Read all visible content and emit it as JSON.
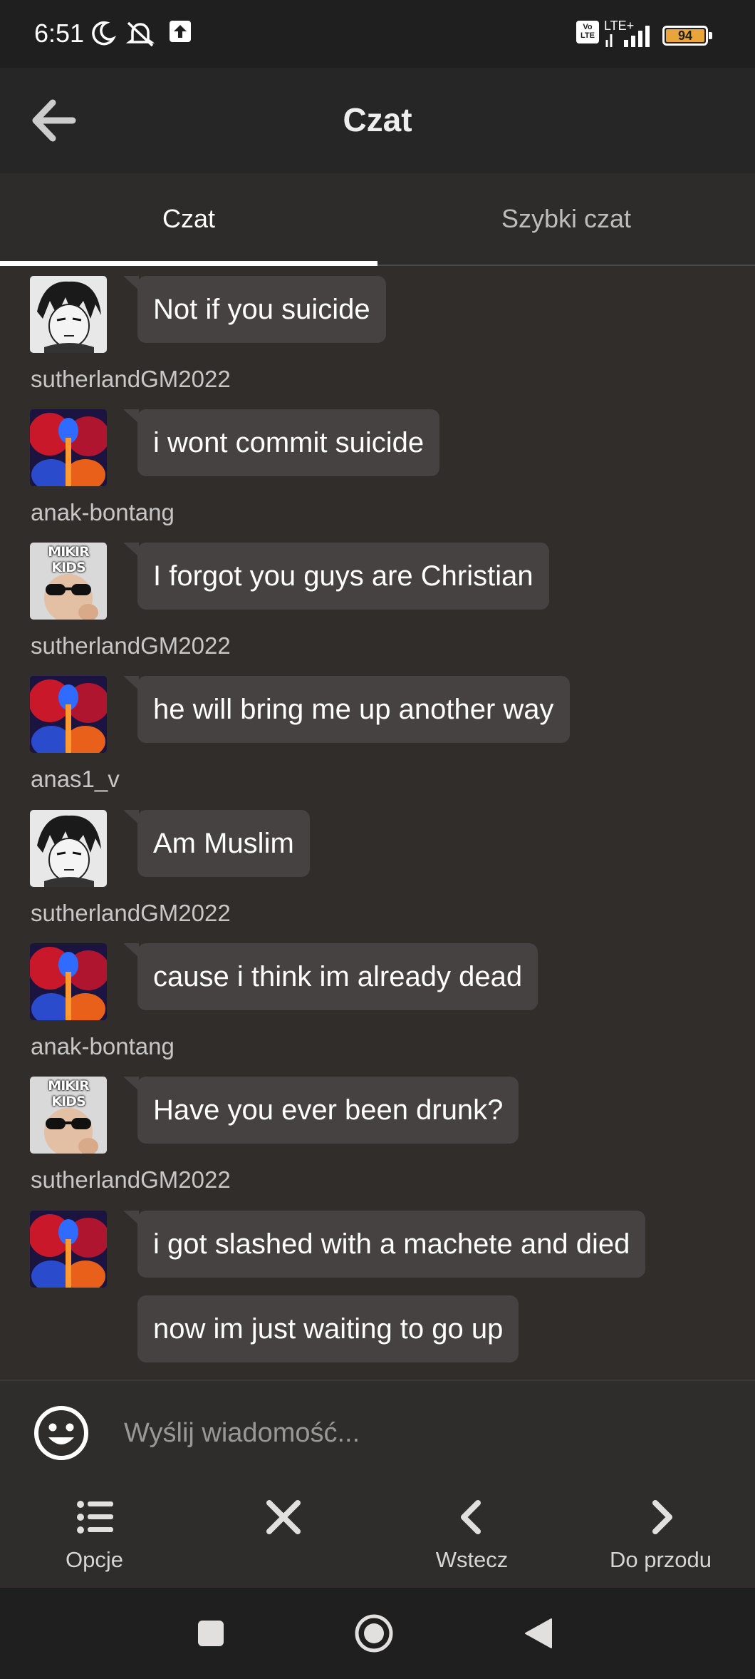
{
  "status_bar": {
    "time": "6:51",
    "network": "LTE+",
    "volte": "Vo LTE",
    "battery": "94",
    "battery_color": "#e8a63a"
  },
  "header": {
    "title": "Czat"
  },
  "tabs": [
    {
      "label": "Czat",
      "active": true
    },
    {
      "label": "Szybki czat",
      "active": false
    }
  ],
  "messages": [
    {
      "text": "Not if you suicide",
      "avatar": "manga-avatar",
      "username": "sutherlandGM2022"
    },
    {
      "text": "i wont commit suicide",
      "avatar": "nebula-avatar",
      "username": "anak-bontang"
    },
    {
      "text": "I forgot you guys are Christian",
      "avatar": "mikir-kids-avatar",
      "avatar_text": "MIKIR KIDS",
      "username": "sutherlandGM2022"
    },
    {
      "text": "he will bring me up another way",
      "avatar": "nebula-avatar",
      "username": "anas1_v"
    },
    {
      "text": "Am Muslim",
      "avatar": "manga-avatar",
      "username": "sutherlandGM2022"
    },
    {
      "text": "cause i think im already dead",
      "avatar": "nebula-avatar",
      "username": "anak-bontang"
    },
    {
      "text": "Have you ever been drunk?",
      "avatar": "mikir-kids-avatar",
      "avatar_text": "MIKIR KIDS",
      "username": "sutherlandGM2022"
    },
    {
      "text": "i got slashed with a machete and died",
      "avatar": "nebula-avatar",
      "username": ""
    },
    {
      "text": "now im just waiting to go up",
      "avatar": "",
      "username": ""
    }
  ],
  "input": {
    "placeholder": "Wyślij wiadomość..."
  },
  "toolbar": {
    "options_label": "Opcje",
    "back_label": "Wstecz",
    "forward_label": "Do przodu"
  }
}
